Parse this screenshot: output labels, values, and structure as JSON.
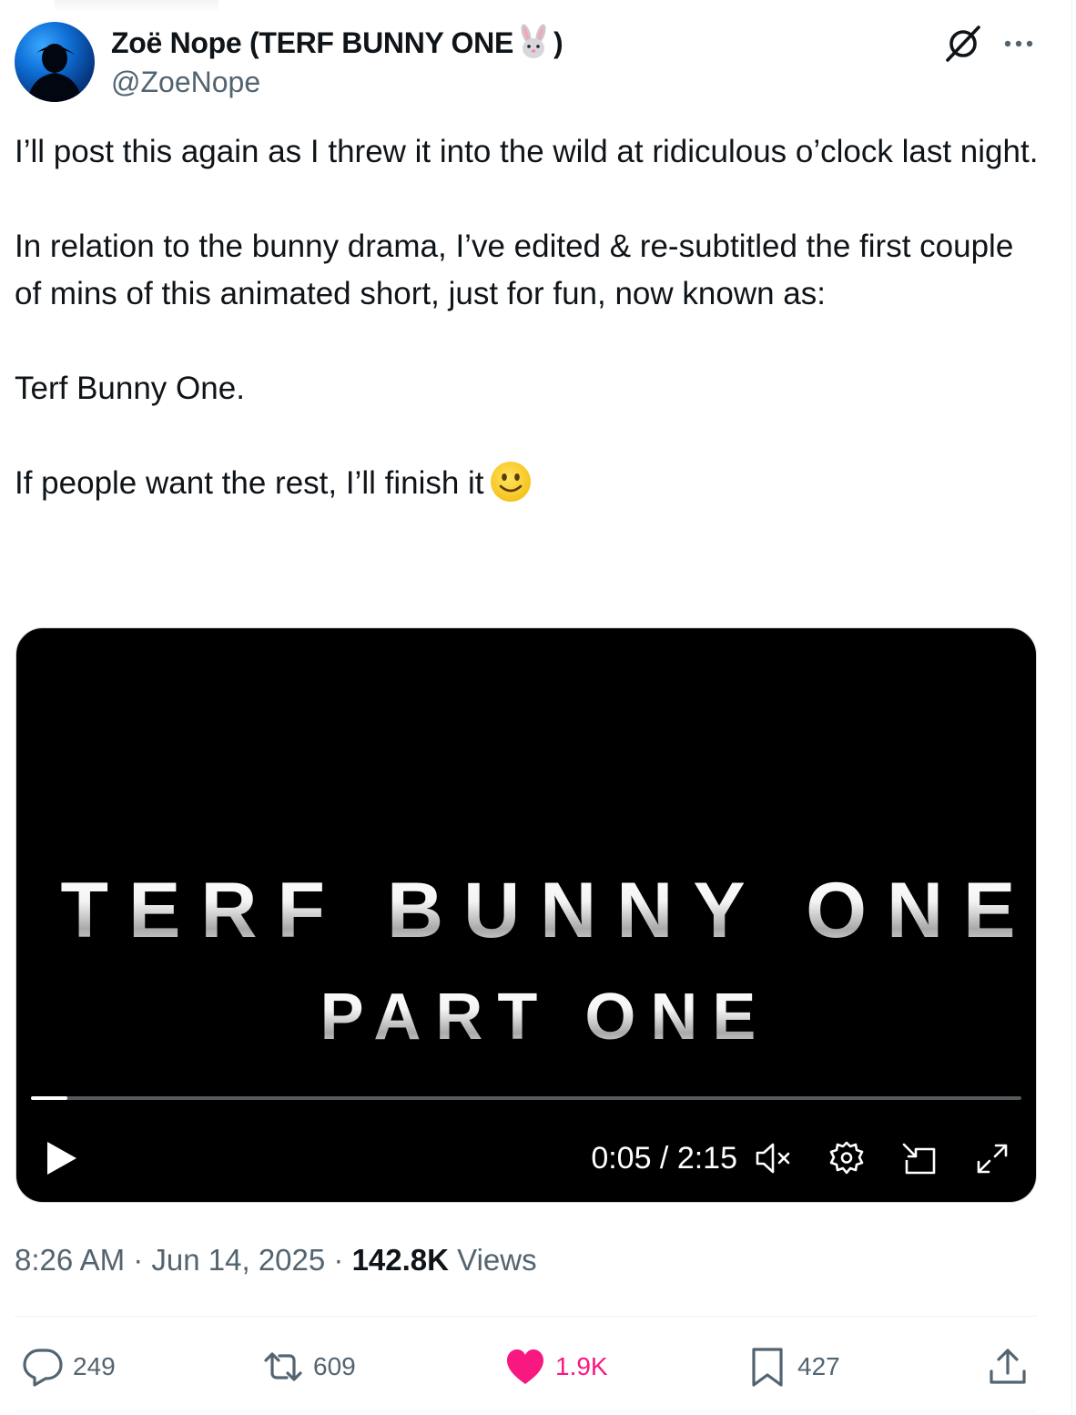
{
  "author": {
    "display_name_prefix": "Zoë Nope (TERF BUNNY ONE",
    "display_name_suffix": ")",
    "bunny_icon": "rabbit-face-emoji",
    "handle": "@ZoeNope"
  },
  "tweet": {
    "paragraphs": [
      "I’ll post this again as I threw it into the wild at ridiculous o’clock last night.",
      "In relation to the bunny drama, I’ve edited & re-subtitled the first couple of mins of this animated short, just for fun, now known as:",
      "Terf Bunny One.",
      "If people want the rest, I’ll finish it"
    ],
    "trailing_emoji": "slightly-smiling-face-emoji"
  },
  "video": {
    "title_line_1": "TERF BUNNY ONE",
    "title_line_2": "PART ONE",
    "time_display": "0:05 / 2:15",
    "progress_fraction": 0.037,
    "muted": true
  },
  "meta": {
    "time": "8:26 AM",
    "separator": " · ",
    "date": "Jun 14, 2025",
    "views_count": "142.8K",
    "views_label": " Views"
  },
  "actions": {
    "replies": "249",
    "reposts": "609",
    "likes": "1.9K",
    "bookmarks": "427"
  },
  "colors": {
    "text": "#0f1419",
    "secondary": "#536471",
    "like": "#f91880",
    "divider": "#eff3f4"
  }
}
